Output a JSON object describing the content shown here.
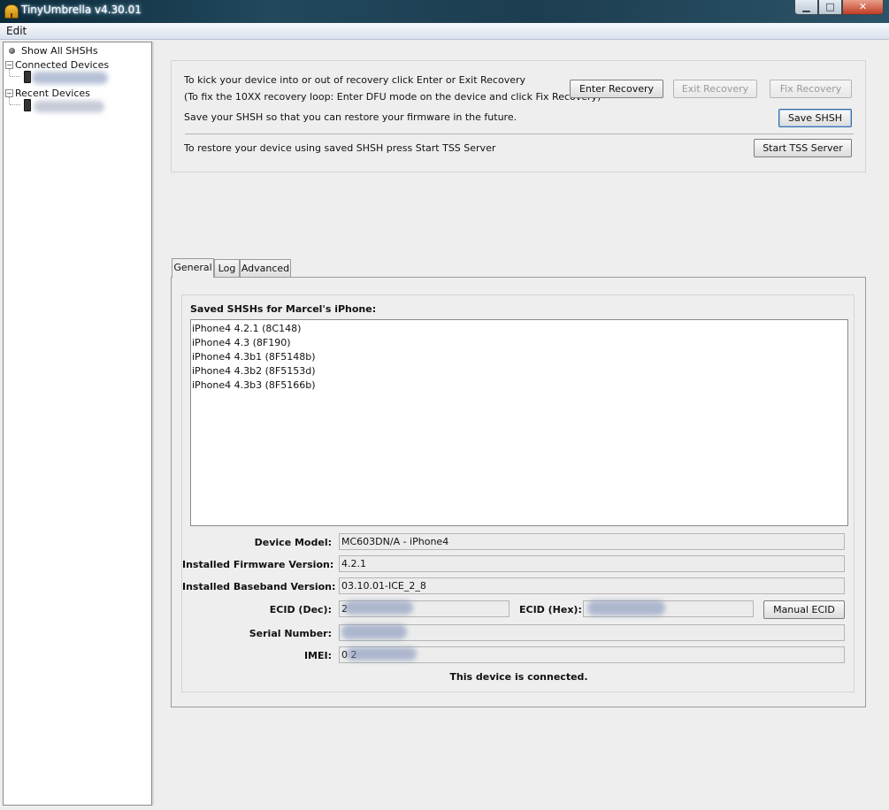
{
  "window": {
    "title": "TinyUmbrella v4.30.01",
    "minimize_glyph": "▁",
    "maximize_glyph": "□",
    "close_glyph": "✕"
  },
  "menu": {
    "items": [
      "Edit"
    ]
  },
  "tree": {
    "show_all": "Show All SHSHs",
    "connected_devices": "Connected Devices",
    "recent_devices": "Recent Devices",
    "expander_glyph": "−"
  },
  "recovery": {
    "line1": "To kick your device into or out of recovery click Enter or Exit Recovery",
    "line2": "(To fix the 10XX recovery loop: Enter DFU mode on the device and click Fix Recovery)",
    "line3": "Save your SHSH so that you can restore your firmware in the future.",
    "line4": "To restore your device using saved SHSH press Start TSS Server",
    "enter_recovery": "Enter Recovery",
    "exit_recovery": "Exit Recovery",
    "fix_recovery": "Fix Recovery",
    "save_shsh": "Save SHSH",
    "start_tss": "Start TSS Server"
  },
  "tabs": [
    "General",
    "Log",
    "Advanced"
  ],
  "general": {
    "saved_title": "Saved SHSHs for Marcel's iPhone:",
    "shsh_list": [
      "iPhone4 4.2.1 (8C148)",
      "iPhone4 4.3 (8F190)",
      "iPhone4 4.3b1 (8F5148b)",
      "iPhone4 4.3b2 (8F5153d)",
      "iPhone4 4.3b3 (8F5166b)"
    ],
    "device_model_label": "Device Model:",
    "device_model": "MC603DN/A - iPhone4",
    "firmware_label": "Installed Firmware Version:",
    "firmware": "4.2.1",
    "baseband_label": "Installed Baseband Version:",
    "baseband": "03.10.01-ICE_2_8",
    "ecid_dec_label": "ECID (Dec):",
    "ecid_dec": "2",
    "ecid_hex_label": "ECID (Hex):",
    "manual_ecid": "Manual ECID",
    "serial_label": "Serial Number:",
    "imei_label": "IMEI:",
    "imei": "0                    2",
    "status": "This device is connected."
  }
}
